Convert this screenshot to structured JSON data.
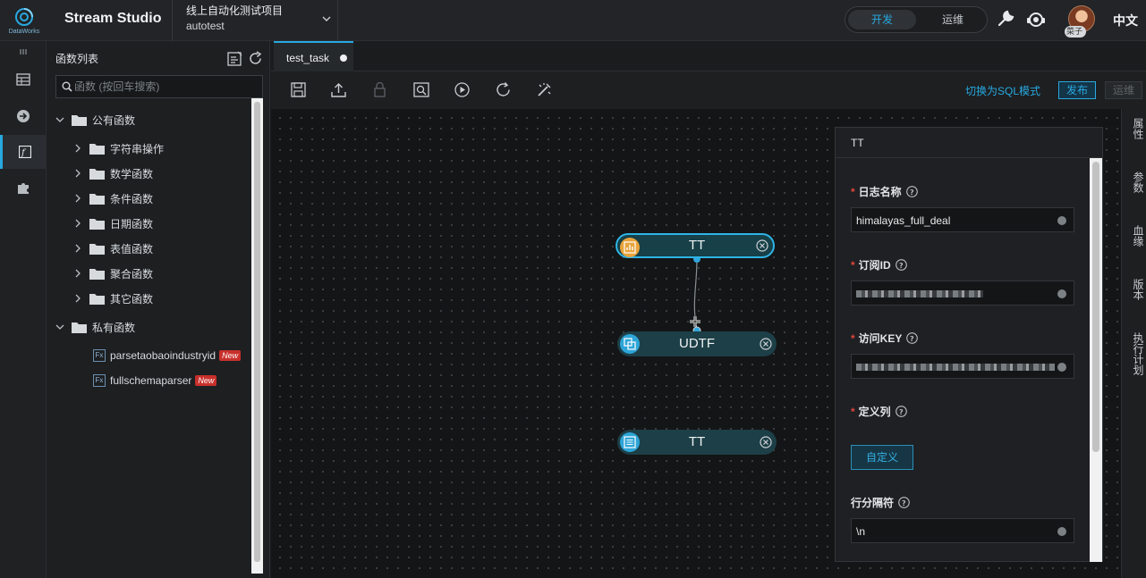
{
  "header": {
    "logo_caption": "DataWorks",
    "app_title": "Stream Studio",
    "project_name": "线上自动化测试项目",
    "project_id": "autotest",
    "mode_dev": "开发",
    "mode_ops": "运维",
    "user_badge": "菜子",
    "language": "中文",
    "icons": [
      "dataworks-logo-icon",
      "chevron-down-icon",
      "wrench-icon",
      "headset-icon",
      "avatar"
    ]
  },
  "rail": {
    "icons": [
      "collapse-icon",
      "table-icon",
      "arrow-right-circle-icon",
      "function-icon",
      "puzzle-icon"
    ]
  },
  "functions": {
    "title": "函数列表",
    "search_placeholder": "函数 (按回车搜索)",
    "public_group": "公有函数",
    "public_items": [
      "字符串操作",
      "数学函数",
      "条件函数",
      "日期函数",
      "表值函数",
      "聚合函数",
      "其它函数"
    ],
    "private_group": "私有函数",
    "private_items": [
      {
        "icon": "Fx",
        "name": "parsetaobaoindustryid",
        "tag": "New"
      },
      {
        "icon": "Fx",
        "name": "fullschemaparser",
        "tag": "New"
      }
    ]
  },
  "editor": {
    "tab_name": "test_task",
    "toolbar_icons": [
      "save-icon",
      "upload-icon",
      "lock-icon",
      "search-view-icon",
      "play-icon",
      "refresh-icon",
      "magic-wand-icon"
    ],
    "switch_sql": "切换为SQL模式",
    "publish": "发布",
    "ops": "运维"
  },
  "nodes": [
    {
      "title": "TT",
      "icon": "chart-icon",
      "selected": true
    },
    {
      "title": "UDTF",
      "icon": "layers-icon",
      "selected": false
    },
    {
      "title": "TT",
      "icon": "table-list-icon",
      "selected": false
    }
  ],
  "properties": {
    "title": "TT",
    "log_name_label": "日志名称",
    "log_name_value": "himalayas_full_deal",
    "sub_id_label": "订阅ID",
    "access_key_label": "访问KEY",
    "define_col_label": "定义列",
    "define_button": "自定义",
    "row_sep_label": "行分隔符",
    "row_sep_value": "\\n"
  },
  "side_tabs": [
    "属性",
    "参数",
    "血缘",
    "版本",
    "执行计划"
  ],
  "colors": {
    "accent": "#28a9e0",
    "required": "#e0453c",
    "new_tag": "#c8302c"
  }
}
